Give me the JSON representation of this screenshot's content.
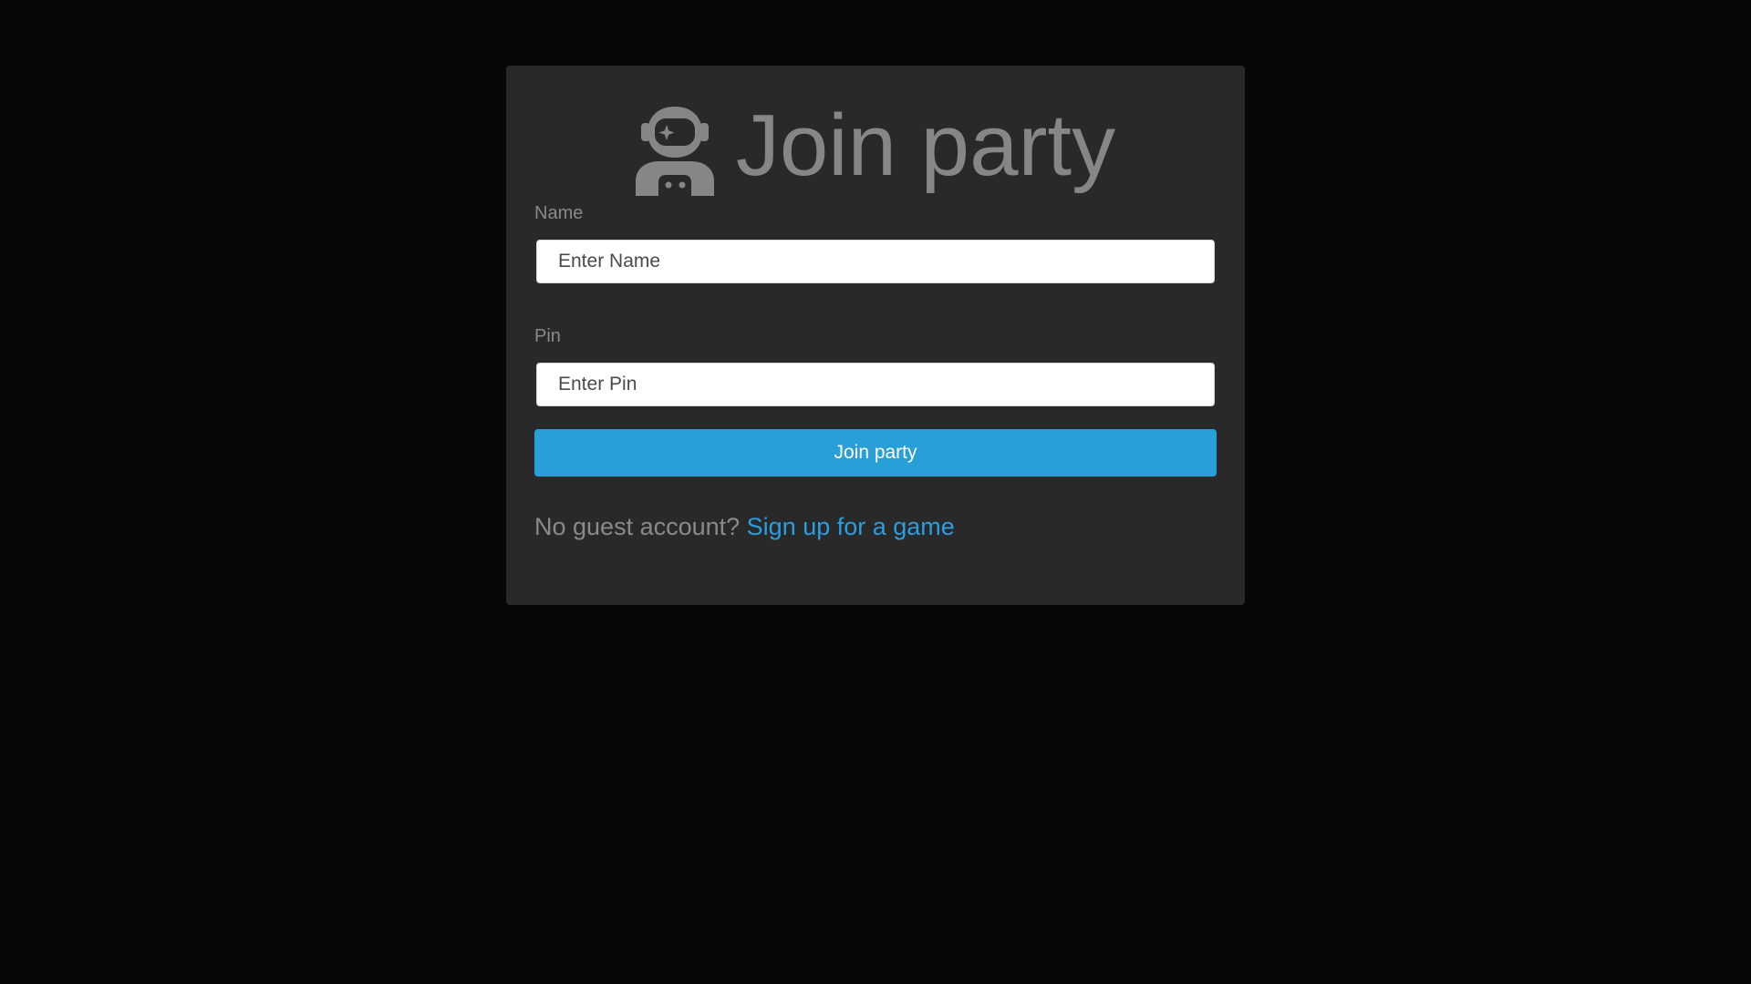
{
  "header": {
    "icon": "astronaut-icon",
    "title": "Join party"
  },
  "form": {
    "name_label": "Name",
    "name_placeholder": "Enter Name",
    "name_value": "",
    "pin_label": "Pin",
    "pin_placeholder": "Enter Pin",
    "pin_value": "",
    "submit_label": "Join party"
  },
  "footer": {
    "prompt_text": "No guest account?",
    "signup_link": "Sign up for a game"
  },
  "colors": {
    "page_background": "#070707",
    "card_background": "#292929",
    "muted_text": "#868686",
    "accent": "#299fd7",
    "link": "#2a9ee0"
  }
}
